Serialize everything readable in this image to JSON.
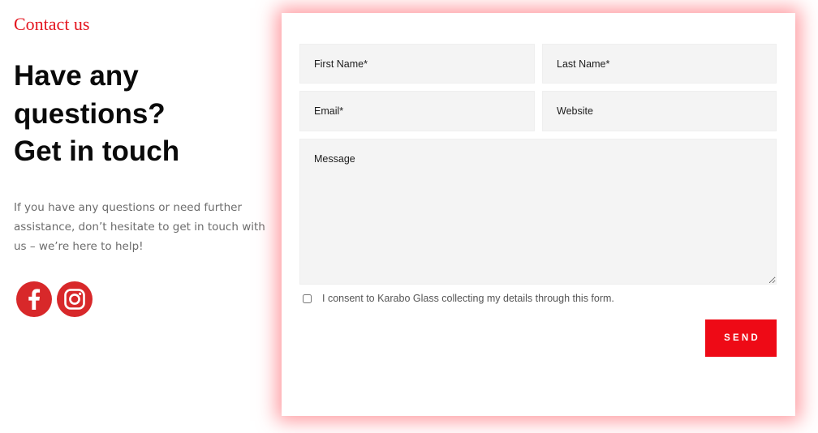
{
  "section": {
    "kicker": "Contact us",
    "headline": [
      "Have any",
      "questions?",
      "Get in touch"
    ],
    "intro": "If you have any questions or need further assistance, don’t hesitate to get in touch with us – we’re here to help!"
  },
  "social": {
    "color": "#d8282a",
    "items": [
      {
        "icon": "facebook-icon"
      },
      {
        "icon": "instagram-icon"
      }
    ]
  },
  "form": {
    "first_name_placeholder": "First Name*",
    "last_name_placeholder": "Last Name*",
    "email_placeholder": "Email*",
    "website_placeholder": "Website",
    "message_placeholder": "Message",
    "consent_label": "I consent to Karabo Glass collecting my details through this form.",
    "consent_checked": false,
    "send_label": "SEND"
  },
  "colors": {
    "accent": "#ee0a16",
    "kicker": "#e4151f",
    "field_background": "#f4f4f4",
    "card_glow": "#ff4650"
  }
}
